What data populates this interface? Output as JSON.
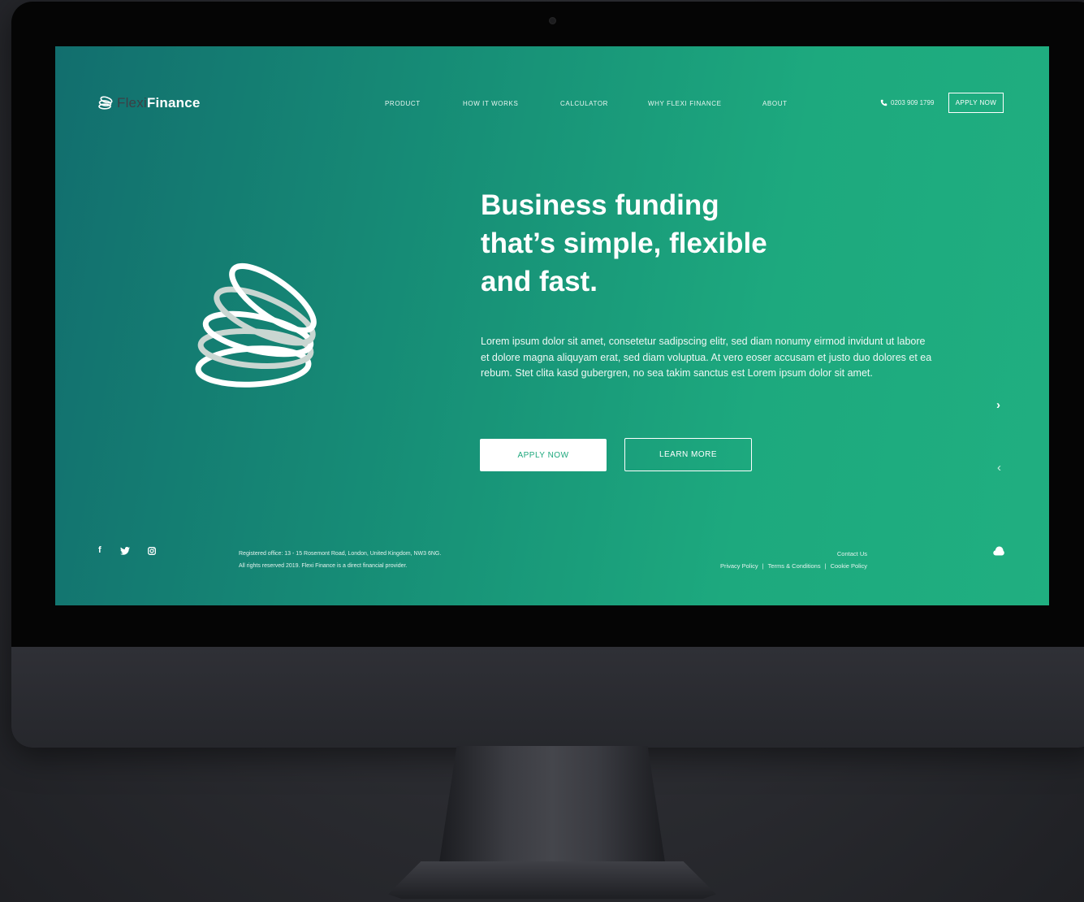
{
  "brand": {
    "name_part1": "Flexi",
    "name_part2": "Finance"
  },
  "nav": {
    "items": [
      {
        "label": "PRODUCT"
      },
      {
        "label": "HOW IT WORKS"
      },
      {
        "label": "CALCULATOR"
      },
      {
        "label": "WHY FLEXI FINANCE"
      },
      {
        "label": "ABOUT"
      }
    ],
    "phone": "0203 909 1799",
    "apply_label": "APPLY NOW"
  },
  "hero": {
    "title_line1": "Business funding",
    "title_line2": "that’s simple, flexible",
    "title_line3": "and fast.",
    "body": "Lorem ipsum dolor sit amet, consetetur sadipscing elitr, sed diam nonumy eirmod invidunt ut labore et dolore magna aliquyam erat, sed diam voluptua. At vero eoser accusam et justo duo dolores et ea rebum. Stet clita kasd gubergren, no sea takim sanctus est Lorem ipsum dolor sit amet.",
    "apply_label": "APPLY NOW",
    "learn_label": "LEARN MORE",
    "next_arrow": "›",
    "prev_arrow": "‹"
  },
  "footer": {
    "social_facebook": "f",
    "office_line": "Registered office: 13 - 15 Rosemont Road, London, United Kingdom, NW3 6NG.",
    "rights_line": "All rights reserved 2019. Flexi Finance is a direct financial provider.",
    "contact_label": "Contact Us",
    "privacy_label": "Privacy Policy",
    "terms_label": "Terms & Conditions",
    "cookie_label": "Cookie Policy",
    "separator": "|"
  },
  "colors": {
    "gradient_start": "#126e6e",
    "gradient_end": "#20af80",
    "accent_green": "#1ea87d",
    "logo_dark": "#3c3f45"
  },
  "icons": {
    "logo": "stacked-rings-icon",
    "hero_art": "stacked-rings-icon",
    "phone": "phone-icon",
    "facebook": "facebook-icon",
    "twitter": "twitter-icon",
    "instagram": "instagram-icon",
    "chat": "chat-bubble-icon"
  }
}
